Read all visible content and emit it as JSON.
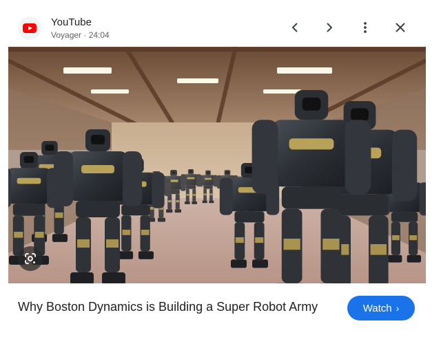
{
  "header": {
    "app_name": "YouTube",
    "subtitle": "Voyager · 24:04",
    "app_icon": "youtube-logo-icon",
    "back_icon": "chevron-left-icon",
    "forward_icon": "chevron-right-icon",
    "menu_icon": "more-vert-icon",
    "close_icon": "close-icon"
  },
  "media": {
    "lens_icon": "google-lens-icon"
  },
  "footer": {
    "caption": "Why Boston Dynamics is Building a Super Robot Army",
    "watch_label": "Watch",
    "watch_chevron": "›"
  },
  "colors": {
    "accent": "#1a73e8",
    "brand": "#ff0000",
    "text": "#202124",
    "subtext": "#5f6368"
  }
}
